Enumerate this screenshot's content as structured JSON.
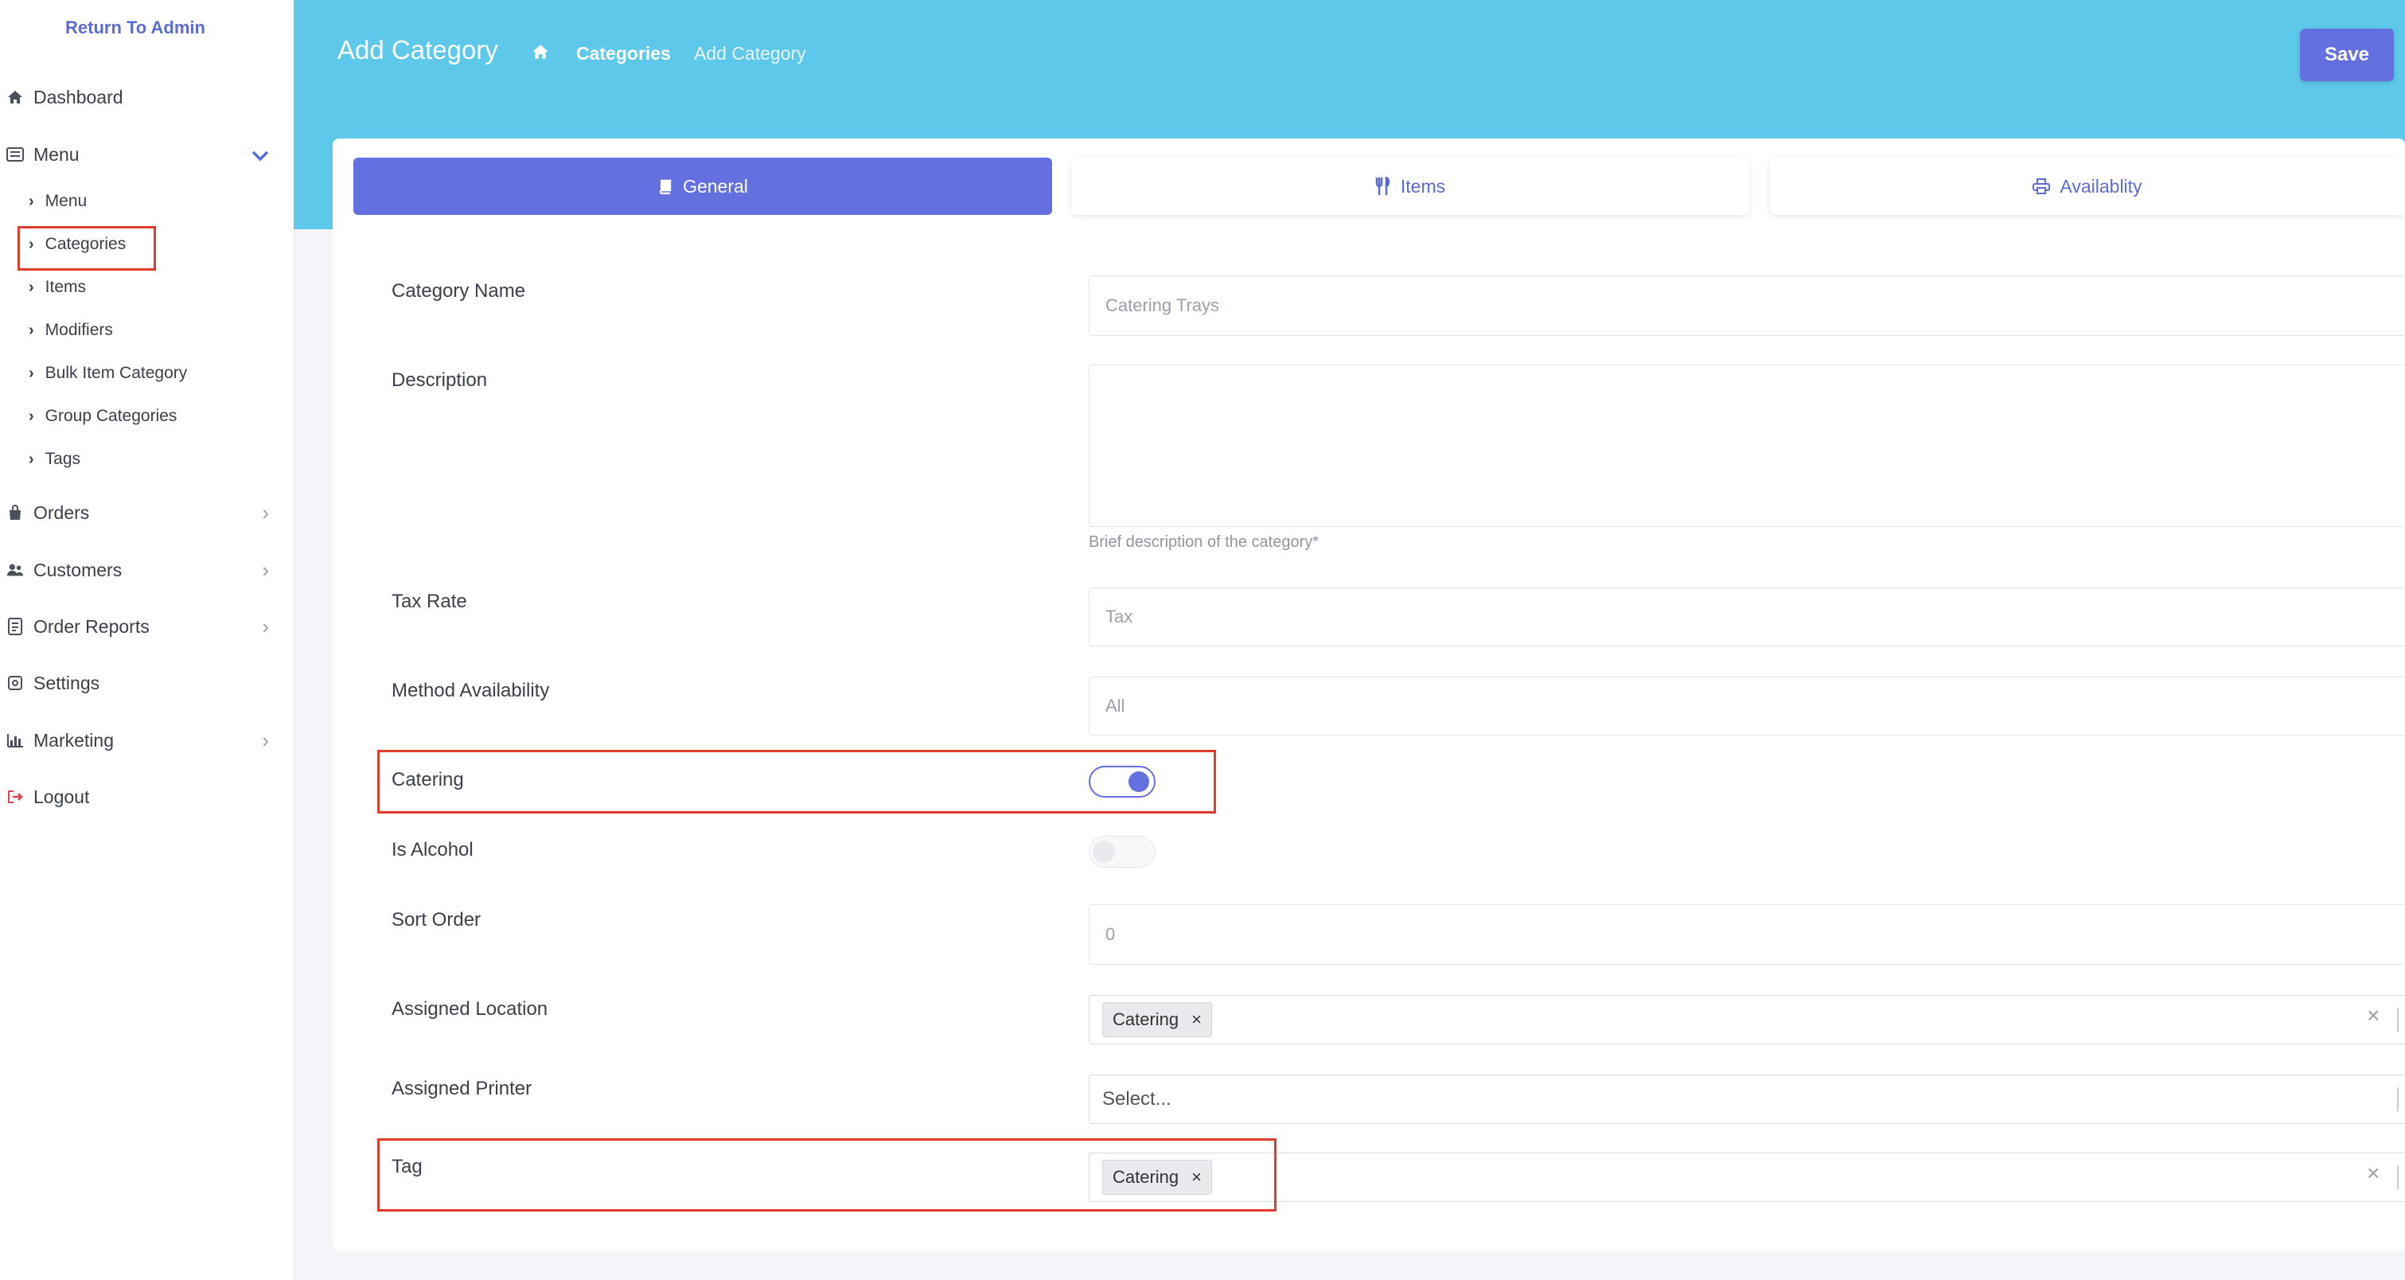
{
  "sidebar": {
    "return_admin": "Return To Admin",
    "dashboard": "Dashboard",
    "menu": "Menu",
    "sub_items": [
      "Menu",
      "Categories",
      "Items",
      "Modifiers",
      "Bulk Item Category",
      "Group Categories",
      "Tags"
    ],
    "orders": "Orders",
    "customers": "Customers",
    "order_reports": "Order Reports",
    "settings": "Settings",
    "marketing": "Marketing",
    "logout": "Logout"
  },
  "header": {
    "title": "Add Category",
    "breadcrumb": [
      "Categories",
      "Add Category"
    ],
    "save_label": "Save"
  },
  "tabs": [
    {
      "label": "General",
      "icon": "book-icon",
      "active": true
    },
    {
      "label": "Items",
      "icon": "utensils-icon",
      "active": false
    },
    {
      "label": "Availablity",
      "icon": "print-icon",
      "active": false
    }
  ],
  "form": {
    "category_name": {
      "label": "Category Name",
      "placeholder": "Catering Trays"
    },
    "description": {
      "label": "Description",
      "help": "Brief description of the category*"
    },
    "tax_rate": {
      "label": "Tax Rate",
      "placeholder": "Tax"
    },
    "method_availability": {
      "label": "Method Availability",
      "value": "All"
    },
    "catering": {
      "label": "Catering",
      "on": true
    },
    "is_alcohol": {
      "label": "Is Alcohol",
      "on": false
    },
    "sort_order": {
      "label": "Sort Order",
      "placeholder": "0"
    },
    "assigned_location": {
      "label": "Assigned Location",
      "chip": "Catering"
    },
    "assigned_printer": {
      "label": "Assigned Printer",
      "placeholder": "Select..."
    },
    "tag": {
      "label": "Tag",
      "chip": "Catering"
    }
  },
  "colors": {
    "header": "#5ec8eb",
    "accent": "#6470e0",
    "highlight": "#e03b2d"
  }
}
